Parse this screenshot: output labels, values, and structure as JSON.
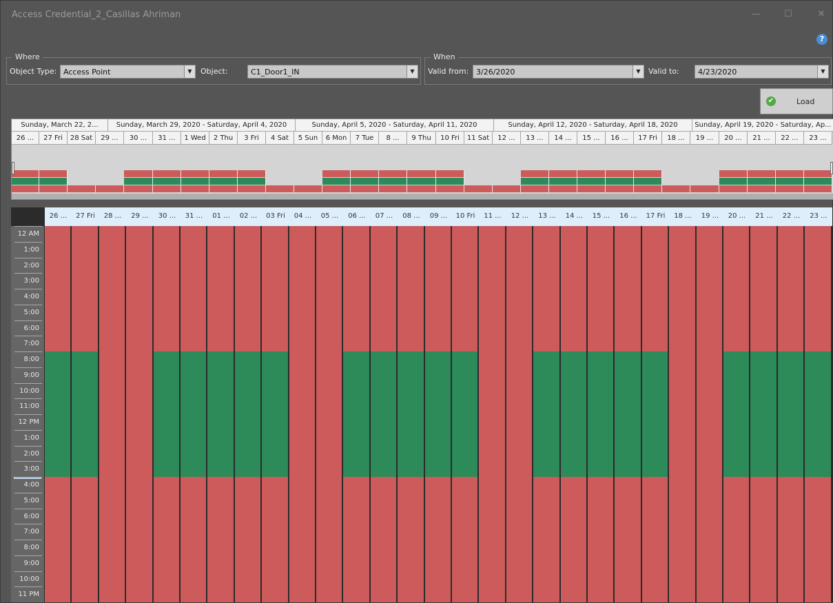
{
  "window": {
    "title": "Access Credential_2_Casillas Ahriman",
    "minimize_glyph": "—",
    "maximize_glyph": "☐",
    "close_glyph": "✕",
    "help_glyph": "?"
  },
  "where": {
    "group_label": "Where",
    "object_type_label": "Object Type:",
    "object_type_value": "Access Point",
    "object_label": "Object:",
    "object_value": "C1_Door1_IN"
  },
  "when": {
    "group_label": "When",
    "valid_from_label": "Valid from:",
    "valid_from_value": "3/26/2020",
    "valid_to_label": "Valid to:",
    "valid_to_value": "4/23/2020"
  },
  "load_button": {
    "label": "Load",
    "icon": "check-icon"
  },
  "colors": {
    "denied": "#cd5b5b",
    "granted": "#2d8a59"
  },
  "overview": {
    "weeks": [
      "Sunday, March 22, 2...",
      "Sunday, March 29, 2020 - Saturday, April 4, 2020",
      "Sunday, April 5, 2020 - Saturday, April 11, 2020",
      "Sunday, April 12, 2020 - Saturday, April 18, 2020",
      "Sunday, April 19, 2020 - Saturday, Ap..."
    ],
    "days": [
      "26 ...",
      "27 Fri",
      "28 Sat",
      "29 ...",
      "30 ...",
      "31 ...",
      "1 Wed",
      "2 Thu",
      "3 Fri",
      "4 Sat",
      "5 Sun",
      "6 Mon",
      "7 Tue",
      "8 ...",
      "9 Thu",
      "10 Fri",
      "11 Sat",
      "12 ...",
      "13 ...",
      "14 ...",
      "15 ...",
      "16 ...",
      "17 Fri",
      "18 ...",
      "19 ...",
      "20 ...",
      "21 ...",
      "22 ...",
      "23 ..."
    ]
  },
  "schedule": {
    "columns": [
      "26 ...",
      "27 Fri",
      "28 ...",
      "29 ...",
      "30 ...",
      "31 ...",
      "01 ...",
      "02 ...",
      "03 Fri",
      "04 ...",
      "05 ...",
      "06 ...",
      "07 ...",
      "08 ...",
      "09 ...",
      "10 Fri",
      "11 ...",
      "12 ...",
      "13 ...",
      "14 ...",
      "15 ...",
      "16 ...",
      "17 Fri",
      "18 ...",
      "19 ...",
      "20 ...",
      "21 ...",
      "22 ...",
      "23 ..."
    ],
    "hours": [
      "12 AM",
      "1:00",
      "2:00",
      "3:00",
      "4:00",
      "5:00",
      "6:00",
      "7:00",
      "8:00",
      "9:00",
      "10:00",
      "11:00",
      "12 PM",
      "1:00",
      "2:00",
      "3:00",
      "4:00",
      "5:00",
      "6:00",
      "7:00",
      "8:00",
      "9:00",
      "10:00",
      "11 PM"
    ],
    "workdays": [
      1,
      1,
      0,
      0,
      1,
      1,
      1,
      1,
      1,
      0,
      0,
      1,
      1,
      1,
      1,
      1,
      0,
      0,
      1,
      1,
      1,
      1,
      1,
      0,
      0,
      1,
      1,
      1,
      1
    ],
    "access_granted_from_hour": 8,
    "access_granted_to_hour": 16
  }
}
